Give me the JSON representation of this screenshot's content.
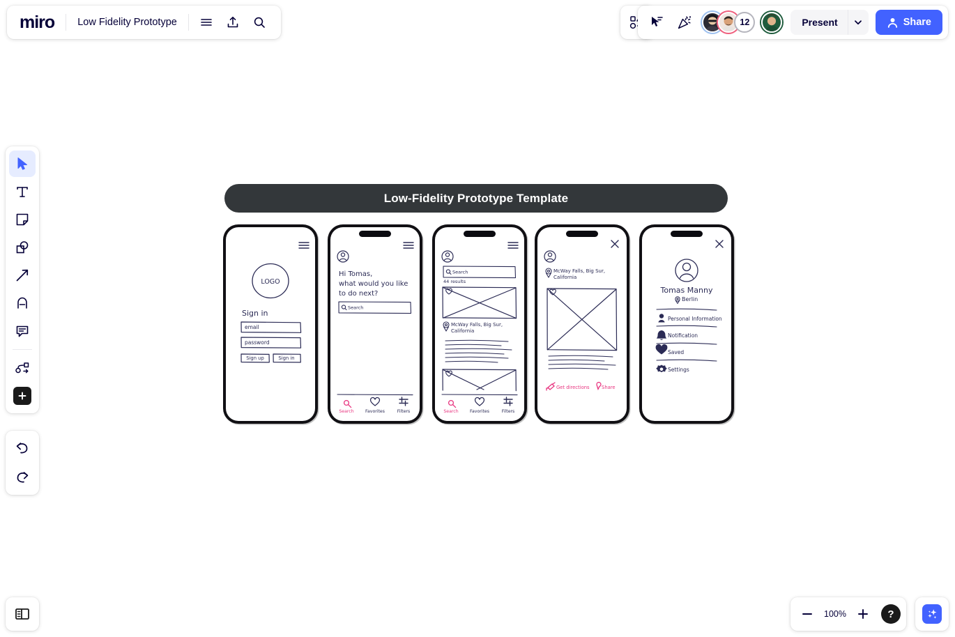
{
  "app": {
    "name": "miro",
    "board_title": "Low Fidelity Prototype"
  },
  "topbar_left": {
    "logo_text": "miro",
    "menu_icon": "hamburger-menu-icon",
    "upload_icon": "upload-icon",
    "search_icon": "search-icon"
  },
  "topbar_right": {
    "templates_icon": "shapes-templates-icon",
    "cursor_icon": "cursor-pointer-icon",
    "celebrate_icon": "party-popper-icon",
    "collaborator_count": "12",
    "present_label": "Present",
    "present_caret_icon": "chevron-down-icon",
    "share_label": "Share",
    "share_icon": "person-icon",
    "share_color": "#4262ff"
  },
  "left_toolbar": {
    "items": [
      {
        "name": "select-tool",
        "icon": "cursor-arrow-icon",
        "active": true
      },
      {
        "name": "text-tool",
        "icon": "text-T-icon",
        "active": false
      },
      {
        "name": "sticky-note-tool",
        "icon": "sticky-note-icon",
        "active": false
      },
      {
        "name": "shapes-tool",
        "icon": "shapes-icon",
        "active": false
      },
      {
        "name": "connector-tool",
        "icon": "arrow-line-icon",
        "active": false
      },
      {
        "name": "pen-tool",
        "icon": "pen-marker-icon",
        "active": false
      },
      {
        "name": "comment-tool",
        "icon": "comment-bubble-icon",
        "active": false
      },
      {
        "name": "frame-flow-tool",
        "icon": "flowchart-icon",
        "active": false
      },
      {
        "name": "more-apps-tool",
        "icon": "plus-square-icon",
        "active": false
      }
    ],
    "undo_icon": "undo-arrow-icon",
    "redo_icon": "redo-arrow-icon"
  },
  "bottom_bar": {
    "panel_toggle_icon": "side-panel-icon",
    "zoom_out_icon": "minus-icon",
    "zoom_level": "100%",
    "zoom_in_icon": "plus-icon",
    "help_label": "?",
    "ai_icon": "ai-sparkle-icon",
    "ai_color": "#4262ff"
  },
  "board": {
    "banner_title": "Low-Fidelity Prototype Template",
    "banner_bg": "#33373a",
    "ink_color": "#2b2b55",
    "accent_color": "#e8347f",
    "screens": [
      {
        "id": "sign-in",
        "menu_icon": "hamburger-menu-icon",
        "logo_label": "LOGO",
        "heading": "Sign in",
        "fields": [
          {
            "name": "email-field",
            "placeholder": "email"
          },
          {
            "name": "password-field",
            "placeholder": "password"
          }
        ],
        "buttons": [
          {
            "name": "sign-up-button",
            "label": "Sign up"
          },
          {
            "name": "sign-in-button",
            "label": "Sign in"
          }
        ]
      },
      {
        "id": "home-greeting",
        "has_notch": true,
        "menu_icon": "hamburger-menu-icon",
        "avatar_icon": "user-avatar-icon",
        "greeting_lines": [
          "Hi Tomas,",
          "what would you like",
          "to do next?"
        ],
        "search_placeholder": "Search",
        "search_icon": "search-icon",
        "nav": [
          {
            "name": "nav-search",
            "label": "Search",
            "icon": "search-icon",
            "active": true
          },
          {
            "name": "nav-favorites",
            "label": "Favorites",
            "icon": "heart-icon",
            "active": false
          },
          {
            "name": "nav-filters",
            "label": "Filters",
            "icon": "filter-sliders-icon",
            "active": false
          }
        ]
      },
      {
        "id": "search-results",
        "has_notch": true,
        "menu_icon": "hamburger-menu-icon",
        "avatar_icon": "user-avatar-icon",
        "search_placeholder": "Search",
        "search_icon": "search-icon",
        "results_count": "44 results",
        "result_title": "McWay Falls, Big Sur, California",
        "location_icon": "map-pin-icon",
        "favorite_icon": "heart-icon",
        "nav": [
          {
            "name": "nav-search",
            "label": "Search",
            "icon": "search-icon",
            "active": true
          },
          {
            "name": "nav-favorites",
            "label": "Favorites",
            "icon": "heart-icon",
            "active": false
          },
          {
            "name": "nav-filters",
            "label": "Filters",
            "icon": "filter-sliders-icon",
            "active": false
          }
        ]
      },
      {
        "id": "place-detail",
        "has_notch": true,
        "close_icon": "close-x-icon",
        "avatar_icon": "user-avatar-icon",
        "location_icon": "map-pin-icon",
        "title": "McWay Falls, Big Sur, California",
        "favorite_icon": "heart-icon",
        "actions": [
          {
            "name": "get-directions-button",
            "label": "Get directions",
            "icon": "directions-icon"
          },
          {
            "name": "share-button",
            "label": "Share",
            "icon": "share-pin-icon"
          }
        ]
      },
      {
        "id": "profile",
        "has_notch": true,
        "close_icon": "close-x-icon",
        "avatar_icon": "user-avatar-large-icon",
        "user_name": "Tomas Manny",
        "location_icon": "map-pin-icon",
        "user_location": "Berlin",
        "menu": [
          {
            "name": "menu-personal-information",
            "label": "Personal Information",
            "icon": "person-icon"
          },
          {
            "name": "menu-notification",
            "label": "Notification",
            "icon": "bell-icon"
          },
          {
            "name": "menu-saved",
            "label": "Saved",
            "icon": "heart-icon"
          },
          {
            "name": "menu-settings",
            "label": "Settings",
            "icon": "gear-icon"
          }
        ]
      }
    ]
  }
}
